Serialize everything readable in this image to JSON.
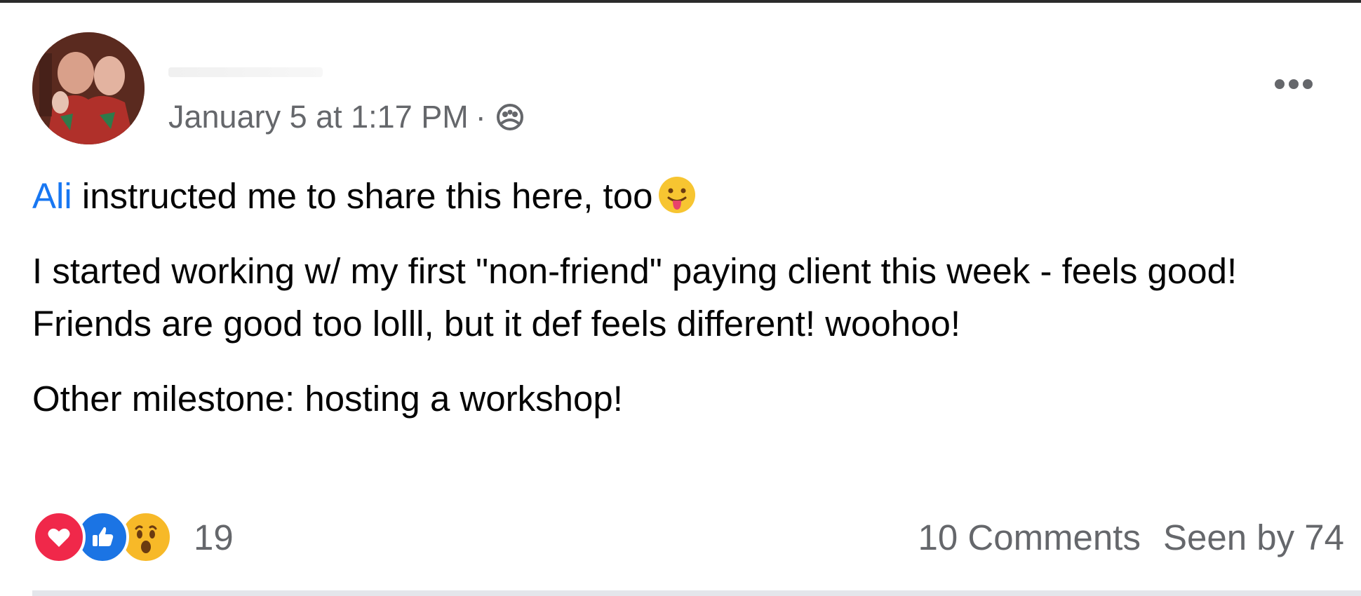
{
  "post": {
    "author_name": "",
    "timestamp": "January 5 at 1:17 PM",
    "separator": "·",
    "privacy_icon": "members-group-icon",
    "more_icon": "more-horizontal-icon",
    "mention": "Ali",
    "line1_rest": " instructed me to share this here, too",
    "line1_emoji": "tongue-out-emoji",
    "paragraph2": "I started working w/ my first \"non-friend\" paying client this week - feels good! Friends are good too lolll, but it def feels different! woohoo!",
    "paragraph3": "Other milestone: hosting a workshop!"
  },
  "footer": {
    "reactions": [
      "love",
      "like",
      "wow"
    ],
    "reaction_count": "19",
    "comments": "10 Comments",
    "seen_by": "Seen by 74"
  },
  "colors": {
    "mention": "#1877f2",
    "meta_text": "#65676b",
    "body_text": "#050505",
    "love": "#f0284a",
    "like": "#1b74e4",
    "wow": "#f7b928"
  }
}
